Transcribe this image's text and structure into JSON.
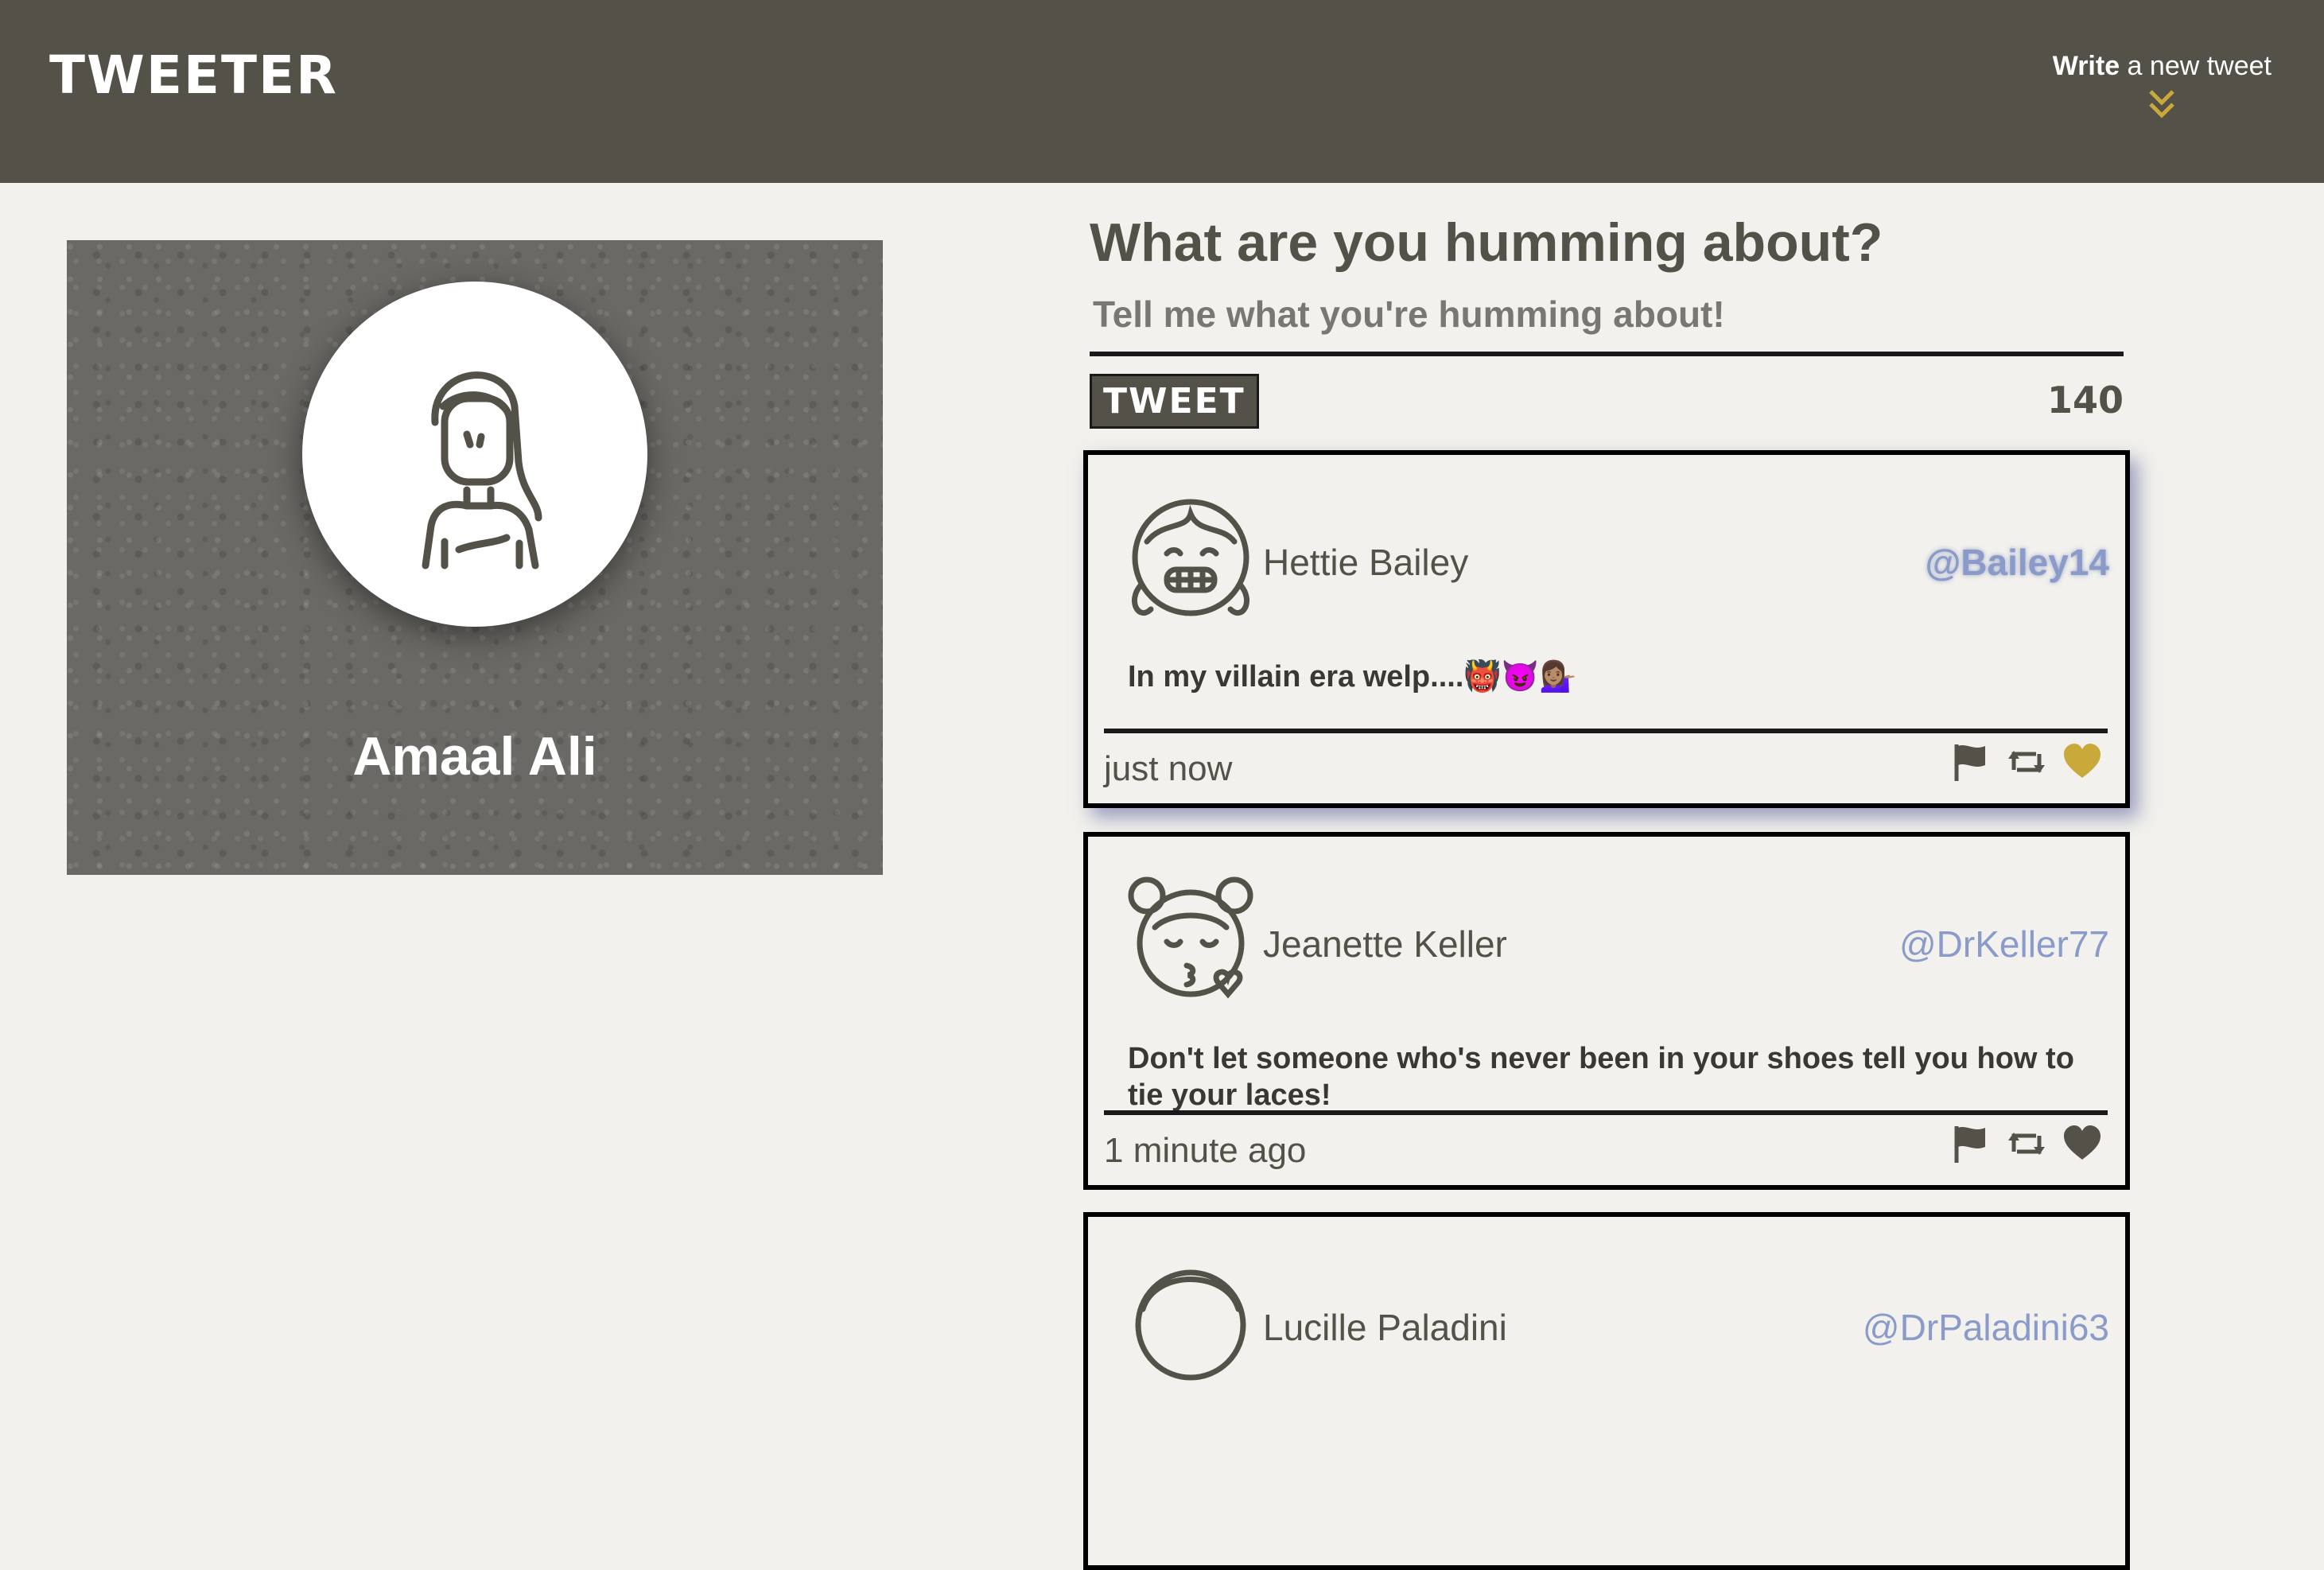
{
  "nav": {
    "brand": "TWEETER",
    "write_bold": "Write",
    "write_rest": " a new tweet"
  },
  "profile": {
    "name": "Amaal Ali"
  },
  "compose": {
    "heading": "What are you humming about?",
    "placeholder": "Tell me what you're humming about!",
    "button": "TWEET",
    "counter": "140"
  },
  "tweets": [
    {
      "name": "Hettie Bailey",
      "handle": "@Bailey14",
      "content": "In my villain era welp....👹😈💁🏽‍♀️",
      "time": "just now",
      "liked": true
    },
    {
      "name": "Jeanette Keller",
      "handle": "@DrKeller77",
      "content": "Don't let someone who's never been in your shoes tell you how to tie your laces!",
      "time": "1 minute ago",
      "liked": false
    },
    {
      "name": "Lucille Paladini",
      "handle": "@DrPaladini63",
      "content": "",
      "time": "",
      "liked": false
    }
  ],
  "colors": {
    "nav_bg": "#545149",
    "page_bg": "#f2f1ed",
    "accent": "#c9a93a",
    "handle": "#8a9bc9"
  }
}
